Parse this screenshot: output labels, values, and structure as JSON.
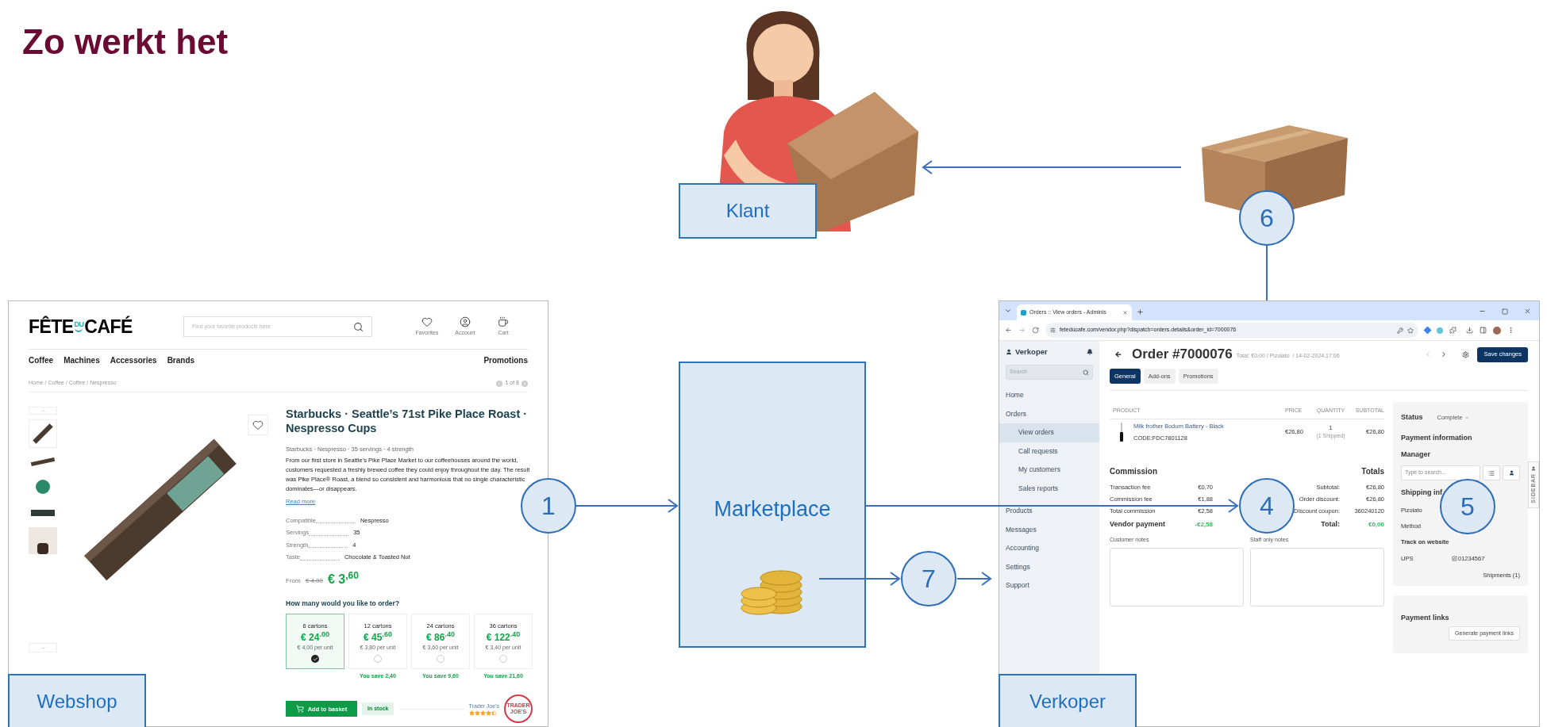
{
  "title": "Zo werkt het",
  "customer": {
    "label": "Klant"
  },
  "marketplace": {
    "label": "Marketplace"
  },
  "steps": [
    {
      "number": "6"
    },
    {
      "number": "1"
    },
    {
      "number": "4"
    },
    {
      "number": "5"
    },
    {
      "number": "7"
    }
  ],
  "webshop": {
    "label": "Webshop",
    "screen": {
      "logo": [
        "FÊTE",
        "DU",
        "CAFÉ"
      ],
      "search_placeholder": "Find your favorite products here",
      "header_links": [
        {
          "kind": "heart",
          "label": "Favorites"
        },
        {
          "kind": "user",
          "label": "Account"
        },
        {
          "kind": "cup",
          "label": "Cart"
        }
      ],
      "nav": [
        "Coffee",
        "Machines",
        "Accessories",
        "Brands"
      ],
      "nav_right": "Promotions",
      "breadcrumb": "Home / Coffee / Coffee / Nespresso",
      "pager": "1 of 8",
      "product": {
        "title": "Starbucks · Seattle’s 71st Pike Place Roast · Nespresso Cups",
        "meta": "Starbucks · Nespresso · 35 servings · 4 strength",
        "description": "From our first store in Seattle’s Pike Place Market to our coffeehouses around the world, customers requested a freshly brewed coffee they could enjoy throughout the day. The result was Pike Place® Roast, a blend so consistent and harmonious that no single characteristic dominates—or disappears.",
        "read_more": "Read more",
        "specs": [
          {
            "key": "Compatible",
            "value": "Nespresso"
          },
          {
            "key": "Servings",
            "value": "35"
          },
          {
            "key": "Strength",
            "value": "4"
          },
          {
            "key": "Taste",
            "value": "Chocolate & Toasted Nut"
          }
        ],
        "price": {
          "from": "From",
          "old": "€ 4,00",
          "new": "€ 3$^{,60}$"
        },
        "order_question": "How many would you like to order?",
        "options": [
          {
            "label": "6 cartons",
            "price": "€ 24$^{.00}$",
            "unit": "€ 4,00 per unit",
            "selected": true
          },
          {
            "label": "12 cartons",
            "price": "€ 45$^{.60}$",
            "unit": "€ 3,80 per unit",
            "saving": "You save 2,40",
            "selected": false
          },
          {
            "label": "24 cartons",
            "price": "€ 86$^{.40}$",
            "unit": "€ 3,60 per unit",
            "saving": "You save 9,60",
            "selected": false
          },
          {
            "label": "36 cartons",
            "price": "€ 122$^{.40}$",
            "unit": "€ 3,40 per unit",
            "saving": "You save 21,60",
            "selected": false
          }
        ],
        "add_to_basket": "Add to basket",
        "stock": "In stock",
        "seller": {
          "name": "Trader Joe's",
          "stars": 4.5,
          "logo": "TRADER JOE'S"
        }
      }
    }
  },
  "vendor": {
    "label": "Verkoper",
    "screen": {
      "tab_title": "Orders :: View orders - Adminis",
      "url": "feteducafe.com/vendor.php?dispatch=orders.details&order_id=7000076",
      "sidebar": {
        "title": "Verkoper",
        "search_placeholder": "Search",
        "items": [
          {
            "label": "Home",
            "selected": false
          },
          {
            "label": "Orders",
            "selected": false,
            "children": [
              {
                "label": "View orders",
                "selected": true
              },
              {
                "label": "Call requests",
                "selected": false
              },
              {
                "label": "My customers",
                "selected": false
              },
              {
                "label": "Sales reports",
                "selected": false
              }
            ]
          },
          {
            "label": "Products",
            "selected": false
          },
          {
            "label": "Messages",
            "selected": false
          },
          {
            "label": "Accounting",
            "selected": false
          },
          {
            "label": "Settings",
            "selected": false
          },
          {
            "label": "Support",
            "selected": false
          }
        ]
      },
      "order": {
        "title": "Order #7000076",
        "summary": "Total: €0,00 / Pizolato  / 14-02-2024,17:06",
        "save": "Save changes",
        "tabs": [
          {
            "label": "General",
            "selected": true
          },
          {
            "label": "Add-ons",
            "selected": false
          },
          {
            "label": "Promotions",
            "selected": false
          }
        ],
        "columns": [
          "PRODUCT",
          "PRICE",
          "QUANTITY",
          "SUBTOTAL"
        ],
        "items": [
          {
            "name": "Milk frother Bodum Battery - Black",
            "code": "CODE:FDC7801128",
            "price": "€26,80",
            "quantity": "1",
            "shipped": "(1 Shipped)",
            "subtotal": "€26,80"
          }
        ],
        "commission": {
          "title": "Commission",
          "rows": [
            {
              "label": "Transaction fee",
              "value": "€0,70"
            },
            {
              "label": "Commission fee",
              "value": "€1,88"
            },
            {
              "label": "Total commission",
              "value": "€2,58"
            }
          ]
        },
        "totals": {
          "title": "Totals",
          "rows": [
            {
              "label": "Subtotal:",
              "value": "€26,80"
            },
            {
              "label": "Order discount:",
              "value": "€26,80"
            },
            {
              "label": "Discount coupon:",
              "value": "360240120"
            }
          ]
        },
        "vendor_payment": {
          "label": "Vendor payment",
          "value": "-€2,58"
        },
        "total": {
          "label": "Total:",
          "value": "€0,00"
        },
        "notes": [
          "Customer notes",
          "Staff only notes"
        ]
      },
      "side": {
        "status_label": "Status",
        "status": "Complete",
        "payment_info": "Payment information",
        "manager": "Manager",
        "manager_placeholder": "Type to search...",
        "shipping_title": "Shipping inf",
        "carrier_name": "Pizolato",
        "method_label": "Method",
        "track_label": "Track on website",
        "carrier": "UPS",
        "tracking": "01234567",
        "shipments": "Shipments (1)",
        "payment_links": "Payment links",
        "generate": "Generate payment links",
        "sidebar_tab": "SIDEBAR"
      }
    }
  }
}
